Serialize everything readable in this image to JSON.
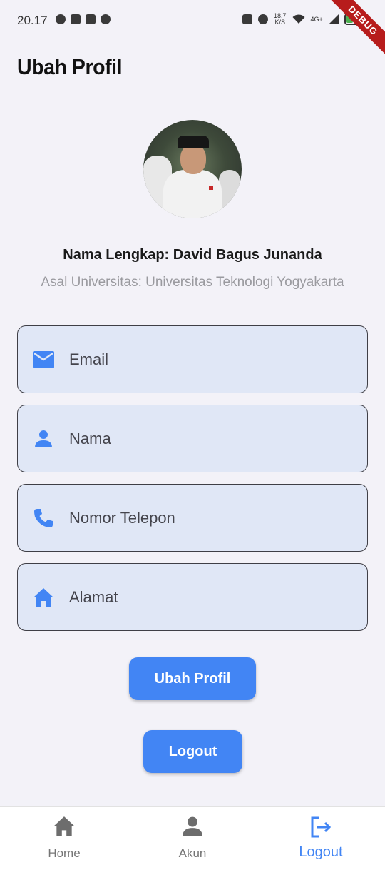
{
  "status_bar": {
    "time": "20.17",
    "speed_value": "18,7",
    "speed_unit": "K/S",
    "network": "4G+",
    "battery": "34"
  },
  "debug_banner": "DEBUG",
  "header": {
    "title": "Ubah Profil"
  },
  "profile": {
    "full_name": "Nama Lengkap: David Bagus Junanda",
    "university": "Asal Universitas: Universitas Teknologi Yogyakarta"
  },
  "form": {
    "email": {
      "placeholder": "Email",
      "icon": "mail-icon",
      "value": ""
    },
    "name": {
      "placeholder": "Nama",
      "icon": "person-icon",
      "value": ""
    },
    "phone": {
      "placeholder": "Nomor Telepon",
      "icon": "phone-icon",
      "value": ""
    },
    "address": {
      "placeholder": "Alamat",
      "icon": "home-icon",
      "value": ""
    }
  },
  "buttons": {
    "update_label": "Ubah Profil",
    "logout_label": "Logout"
  },
  "bottom_nav": {
    "items": [
      {
        "label": "Home",
        "icon": "home-icon",
        "active": false
      },
      {
        "label": "Akun",
        "icon": "person-icon",
        "active": false
      },
      {
        "label": "Logout",
        "icon": "logout-icon",
        "active": true
      }
    ]
  },
  "colors": {
    "accent": "#4285f4",
    "field_background": "#e0e7f6",
    "page_background": "#f3f2f8",
    "muted_text": "#9a9a9f"
  }
}
